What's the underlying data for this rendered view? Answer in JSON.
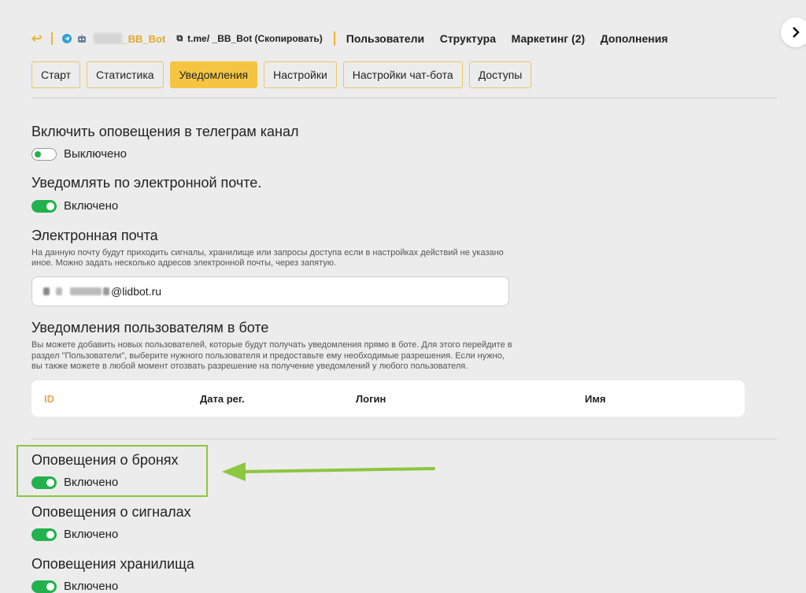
{
  "header": {
    "back_icon": "↩",
    "bot_name_suffix": "_BB_Bot",
    "link_text": "t.me/        _BB_Bot (Скопировать)",
    "nav": [
      "Пользователи",
      "Структура",
      "Маркетинг (2)",
      "Дополнения"
    ]
  },
  "tabs": [
    {
      "label": "Старт",
      "active": false
    },
    {
      "label": "Статистика",
      "active": false
    },
    {
      "label": "Уведомления",
      "active": true
    },
    {
      "label": "Настройки",
      "active": false
    },
    {
      "label": "Настройки чат-бота",
      "active": false
    },
    {
      "label": "Доступы",
      "active": false
    }
  ],
  "settings": {
    "telegram_channel": {
      "title": "Включить оповещения в телеграм канал",
      "status": "Выключено"
    },
    "email_notify": {
      "title": "Уведомлять по электронной почте.",
      "status": "Включено"
    },
    "email_field": {
      "title": "Электронная почта",
      "desc1": "На данную почту будут приходить сигналы, хранилище или запросы доступа если в настройках действий не указано",
      "desc2": "иное. Можно задать несколько адресов электронной почты, через запятую.",
      "value_suffix": "@lidbot.ru"
    },
    "bot_users": {
      "title": "Уведомления пользователям в боте",
      "desc1": "Вы можете добавить новых пользователей, которые будут получать уведомления прямо в боте. Для этого перейдите в",
      "desc2": "раздел \"Пользователи\", выберите нужного пользователя и предоставьте ему необходимые разрешения. Если нужно,",
      "desc3": "вы также можете в любой момент отозвать разрешение на получение уведомлений у любого пользователя.",
      "columns": [
        "ID",
        "Дата рег.",
        "Логин",
        "Имя"
      ]
    },
    "bookings": {
      "title": "Оповещения о бронях",
      "status": "Включено"
    },
    "signals": {
      "title": "Оповещения о сигналах",
      "status": "Включено"
    },
    "storage": {
      "title": "Оповещения хранилища",
      "status": "Включено"
    }
  },
  "colors": {
    "accent": "#f5c542",
    "toggle_on": "#22b14c",
    "annotation": "#8dc63f",
    "id_header": "#e9a65a"
  }
}
